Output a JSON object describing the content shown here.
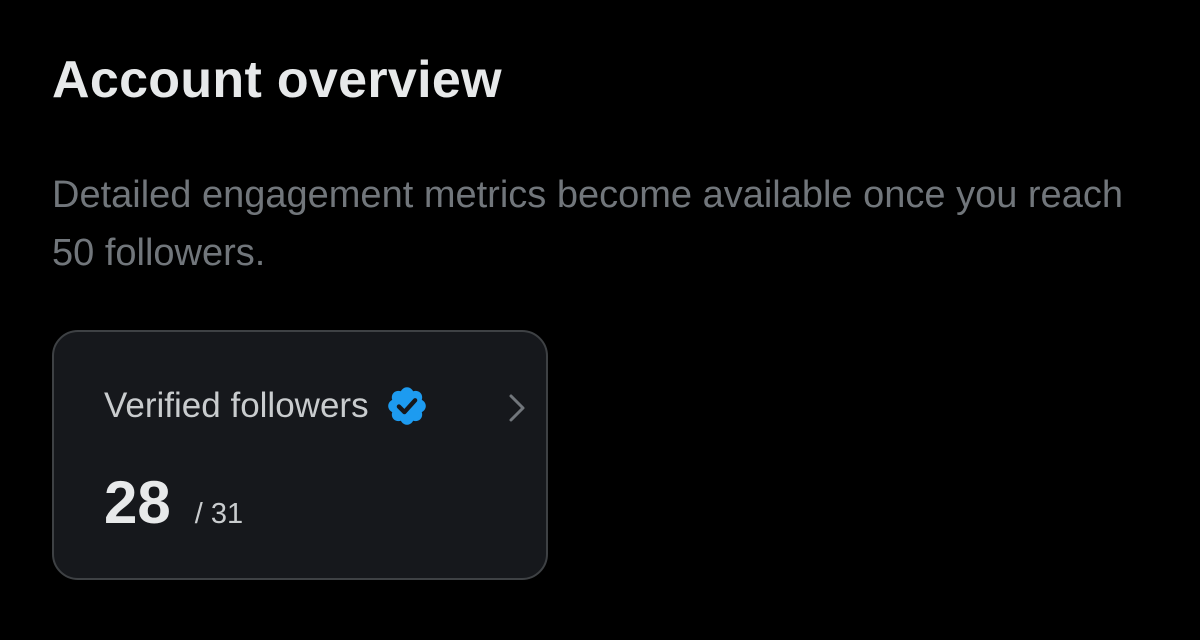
{
  "header": {
    "title": "Account overview",
    "description": "Detailed engagement metrics become available once you reach 50 followers."
  },
  "verified_card": {
    "label": "Verified followers",
    "value": "28",
    "total": "/ 31",
    "badge_icon": "verified-badge-icon",
    "chevron_icon": "chevron-right-icon"
  },
  "colors": {
    "background": "#000000",
    "primary_text": "#e7e9ea",
    "secondary_text": "#71767b",
    "card_background": "#16181c",
    "card_border": "#3e4144",
    "verified_blue": "#1d9bf0"
  }
}
